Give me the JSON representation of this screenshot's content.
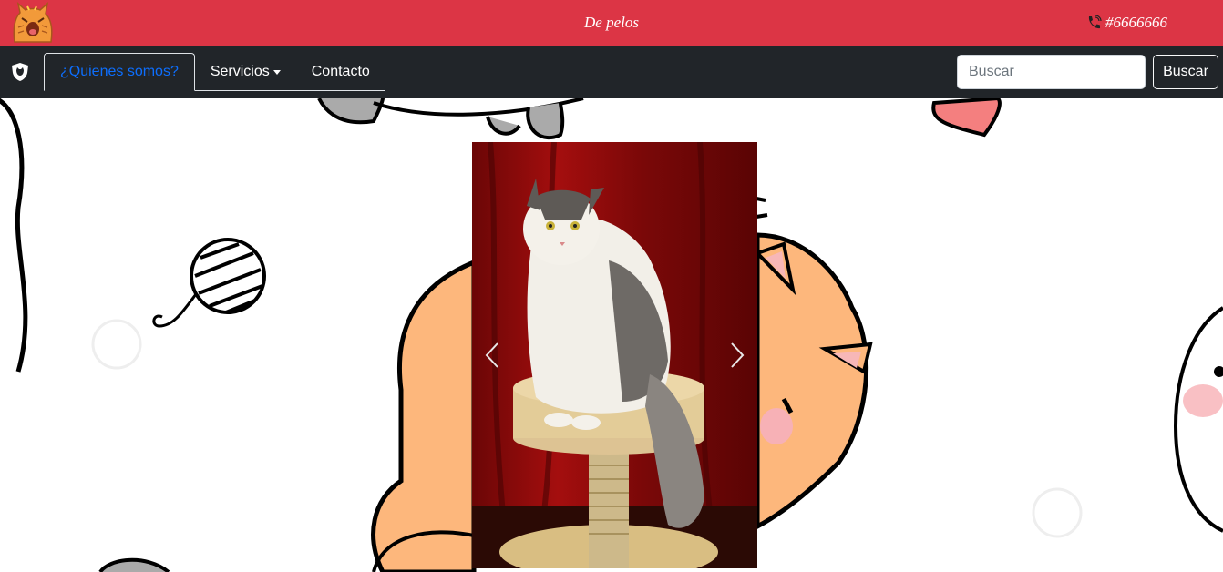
{
  "header": {
    "brand": "De pelos",
    "phone": "#6666666",
    "logo_icon": "cat-logo-icon",
    "phone_icon": "phone-icon"
  },
  "navbar": {
    "shield_icon": "shield-cat-icon",
    "tabs": [
      {
        "label": "¿Quienes somos?",
        "active": true
      },
      {
        "label": "Servicios",
        "dropdown": true
      },
      {
        "label": "Contacto"
      }
    ],
    "search": {
      "placeholder": "Buscar",
      "value": ""
    },
    "search_button": "Buscar"
  },
  "carousel": {
    "image": "cat-on-scratching-post-photo",
    "prev_icon": "chevron-left-icon",
    "next_icon": "chevron-right-icon"
  },
  "colors": {
    "topbar": "#dc3545",
    "navbar": "#212529",
    "active_tab_text": "#0d6efd",
    "background_cat": "#fdb77c"
  }
}
